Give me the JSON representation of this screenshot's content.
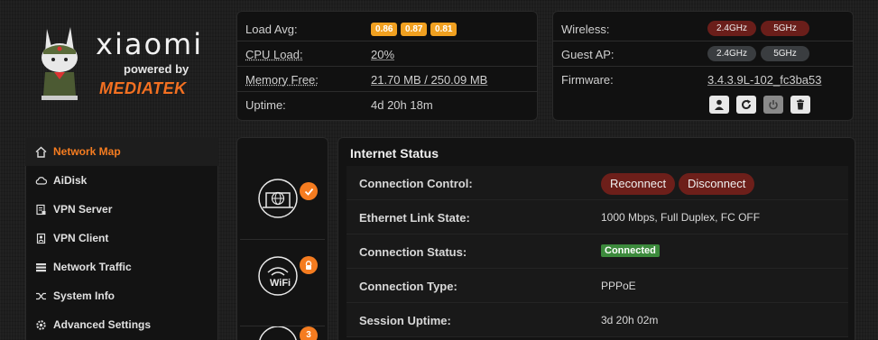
{
  "brand": {
    "name": "xiaomi",
    "powered": "powered by",
    "vendor": "MEDIATEK"
  },
  "status": {
    "load_avg_label": "Load Avg:",
    "load_avg": [
      "0.86",
      "0.87",
      "0.81"
    ],
    "cpu_label": "CPU Load:",
    "cpu_value": "20%",
    "mem_label": "Memory Free:",
    "mem_value": "21.70 MB / 250.09 MB",
    "uptime_label": "Uptime:",
    "uptime_value": "4d 20h 18m"
  },
  "radio": {
    "wireless_label": "Wireless:",
    "guest_label": "Guest AP:",
    "firmware_label": "Firmware:",
    "band_24": "2.4GHz",
    "band_5": "5GHz",
    "firmware": "3.4.3.9L-102_fc3ba53"
  },
  "sidebar": {
    "items": [
      {
        "label": "Network Map",
        "icon": "home-icon"
      },
      {
        "label": "AiDisk",
        "icon": "cloud-icon"
      },
      {
        "label": "VPN Server",
        "icon": "vpn-server-icon"
      },
      {
        "label": "VPN Client",
        "icon": "vpn-client-icon"
      },
      {
        "label": "Network Traffic",
        "icon": "traffic-icon"
      },
      {
        "label": "System Info",
        "icon": "shuffle-icon"
      },
      {
        "label": "Advanced Settings",
        "icon": "gear-icon"
      }
    ]
  },
  "icons": {
    "wifi_text": "WiFi",
    "badge_count": "3"
  },
  "internet": {
    "title": "Internet Status",
    "control_label": "Connection Control:",
    "reconnect": "Reconnect",
    "disconnect": "Disconnect",
    "eth_label": "Ethernet Link State:",
    "eth_value": "1000 Mbps, Full Duplex, FC OFF",
    "status_label": "Connection Status:",
    "status_value": "Connected",
    "type_label": "Connection Type:",
    "type_value": "PPPoE",
    "session_label": "Session Uptime:",
    "session_value": "3d 20h 02m"
  },
  "colors": {
    "accent": "#f57c20",
    "badge": "#f0a020",
    "danger": "#6d1f1a",
    "ok": "#3c8a3c"
  }
}
